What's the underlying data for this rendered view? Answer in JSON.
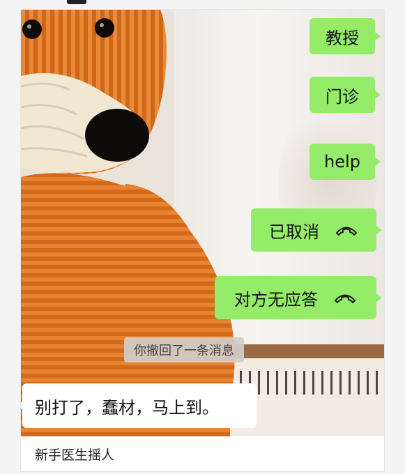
{
  "messages": [
    {
      "side": "right",
      "text": "教授"
    },
    {
      "side": "right",
      "text": "门诊"
    },
    {
      "side": "right",
      "text": "help"
    },
    {
      "side": "right",
      "text": "已取消",
      "icon": "phone-hangup-icon"
    },
    {
      "side": "right",
      "text": "对方无应答",
      "icon": "phone-hangup-icon"
    },
    {
      "side": "left",
      "text": "别打了，蠢材，马上到。"
    }
  ],
  "system_notice": "你撤回了一条消息",
  "footer": {
    "caption": "新手医生摇人"
  },
  "colors": {
    "bubble_green": "#95ec69",
    "bubble_white": "#ffffff",
    "bear_orange": "#d46a1c"
  }
}
